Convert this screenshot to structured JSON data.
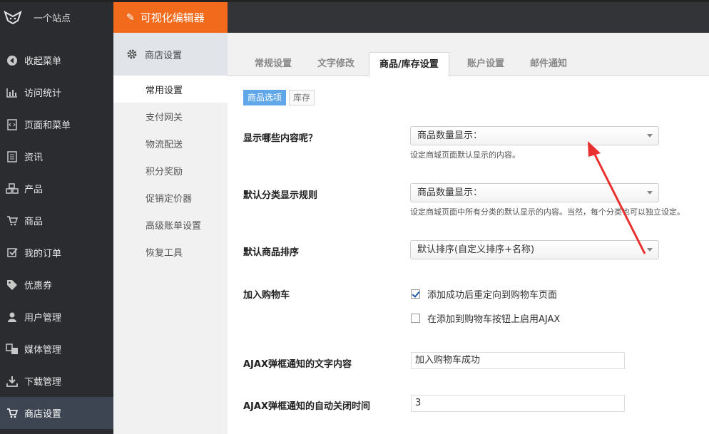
{
  "topbar": {
    "site_name": "一个站点",
    "editor_tab": "可视化编辑器"
  },
  "sidebar": {
    "items": [
      {
        "label": "收起菜单",
        "icon": "collapse-icon"
      },
      {
        "label": "访问统计",
        "icon": "chart-icon"
      },
      {
        "label": "页面和菜单",
        "icon": "page-icon"
      },
      {
        "label": "资讯",
        "icon": "document-icon"
      },
      {
        "label": "产品",
        "icon": "cubes-icon"
      },
      {
        "label": "商品",
        "icon": "cart-icon"
      },
      {
        "label": "我的订单",
        "icon": "checkbox-icon"
      },
      {
        "label": "优惠券",
        "icon": "tag-icon"
      },
      {
        "label": "用户管理",
        "icon": "user-icon"
      },
      {
        "label": "媒体管理",
        "icon": "media-icon"
      },
      {
        "label": "下载管理",
        "icon": "download-icon"
      },
      {
        "label": "商店设置",
        "icon": "cart-icon"
      }
    ]
  },
  "submenu": {
    "header": "商店设置",
    "items": [
      "常用设置",
      "支付网关",
      "物流配送",
      "积分奖励",
      "促销定价器",
      "高级账单设置",
      "恢复工具"
    ]
  },
  "tabs": [
    "常规设置",
    "文字修改",
    "商品/库存设置",
    "账户设置",
    "邮件通知"
  ],
  "subtabs": [
    "商品选项",
    "库存"
  ],
  "form": {
    "display_label": "显示哪些内容呢？",
    "display_value": "商品数量显示：",
    "display_help": "设定商城页面默认显示的内容。",
    "category_label": "默认分类显示规则",
    "category_value": "商品数量显示：",
    "category_help": "设定商城页面中所有分类的默认显示的内容。当然，每个分类也可以独立设定。",
    "sort_label": "默认商品排序",
    "sort_value": "默认排序(自定义排序+名称)",
    "cart_label": "加入购物车",
    "cart_redirect": "添加成功后重定向到购物车页面",
    "cart_ajax": "在添加到购物车按钮上启用AJAX",
    "ajax_text_label": "AJAX弹框通知的文字内容",
    "ajax_text_value": "加入购物车成功",
    "ajax_time_label": "AJAX弹框通知的自动关闭时间",
    "ajax_time_value": "3"
  },
  "colors": {
    "accent": "#f26b1d",
    "sidebar_bg": "#2b2c30",
    "subtab_active": "#5fa7e8",
    "annotation_arrow": "#e8312f"
  }
}
